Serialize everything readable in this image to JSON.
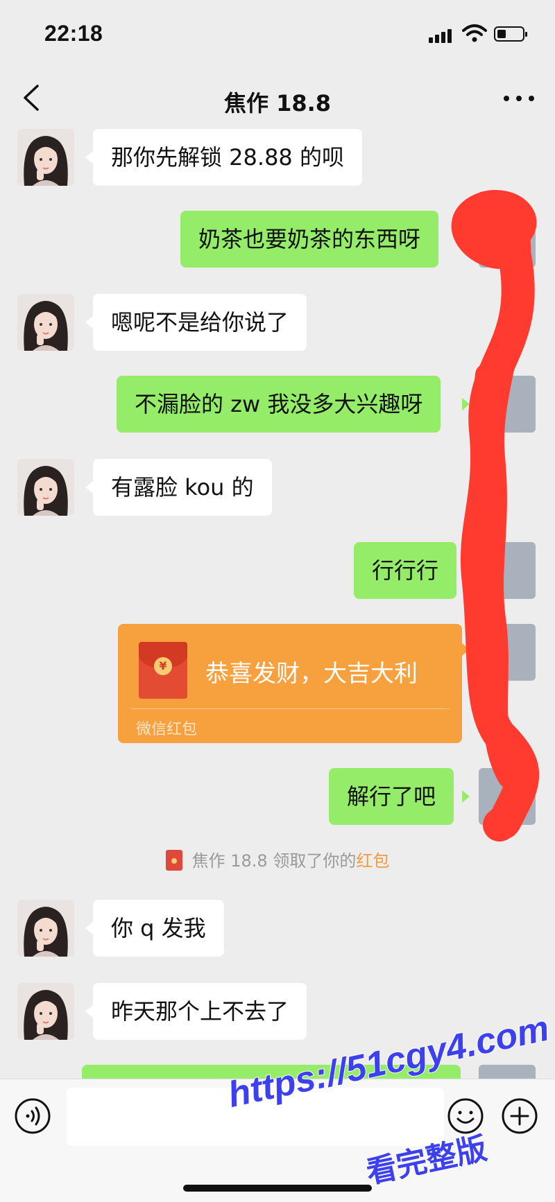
{
  "status_bar": {
    "time": "22:18"
  },
  "header": {
    "title": "焦作 18.8"
  },
  "messages": [
    {
      "side": "left",
      "text": "那你先解锁 28.88 的呗"
    },
    {
      "side": "right",
      "text": "奶茶也要奶茶的东西呀"
    },
    {
      "side": "left",
      "text": "嗯呢不是给你说了"
    },
    {
      "side": "right",
      "text": "不漏脸的 zw 我没多大兴趣呀"
    },
    {
      "side": "left",
      "text": "有露脸 kou 的"
    },
    {
      "side": "right",
      "text": "行行行"
    },
    {
      "side": "right",
      "text": "解行了吧"
    },
    {
      "side": "left",
      "text": "你 q 发我"
    },
    {
      "side": "left",
      "text": "昨天那个上不去了"
    }
  ],
  "red_packet": {
    "greeting": "恭喜发财，大吉大利",
    "label": "微信红包",
    "icon": "yuan-icon",
    "symbol": "¥"
  },
  "system_message": {
    "prefix": "焦作 18.8 领取了你的",
    "highlight": "红包"
  },
  "input": {
    "placeholder": ""
  },
  "watermark": {
    "url": "https://51cgy4.com",
    "text": "看完整版"
  },
  "colors": {
    "background": "#ededed",
    "bubble_green": "#95ec69",
    "bubble_white": "#ffffff",
    "red_packet": "#f6a03e",
    "highlight": "#f29b3c",
    "scribble": "#ff3b30",
    "watermark": "#3c40ef"
  }
}
